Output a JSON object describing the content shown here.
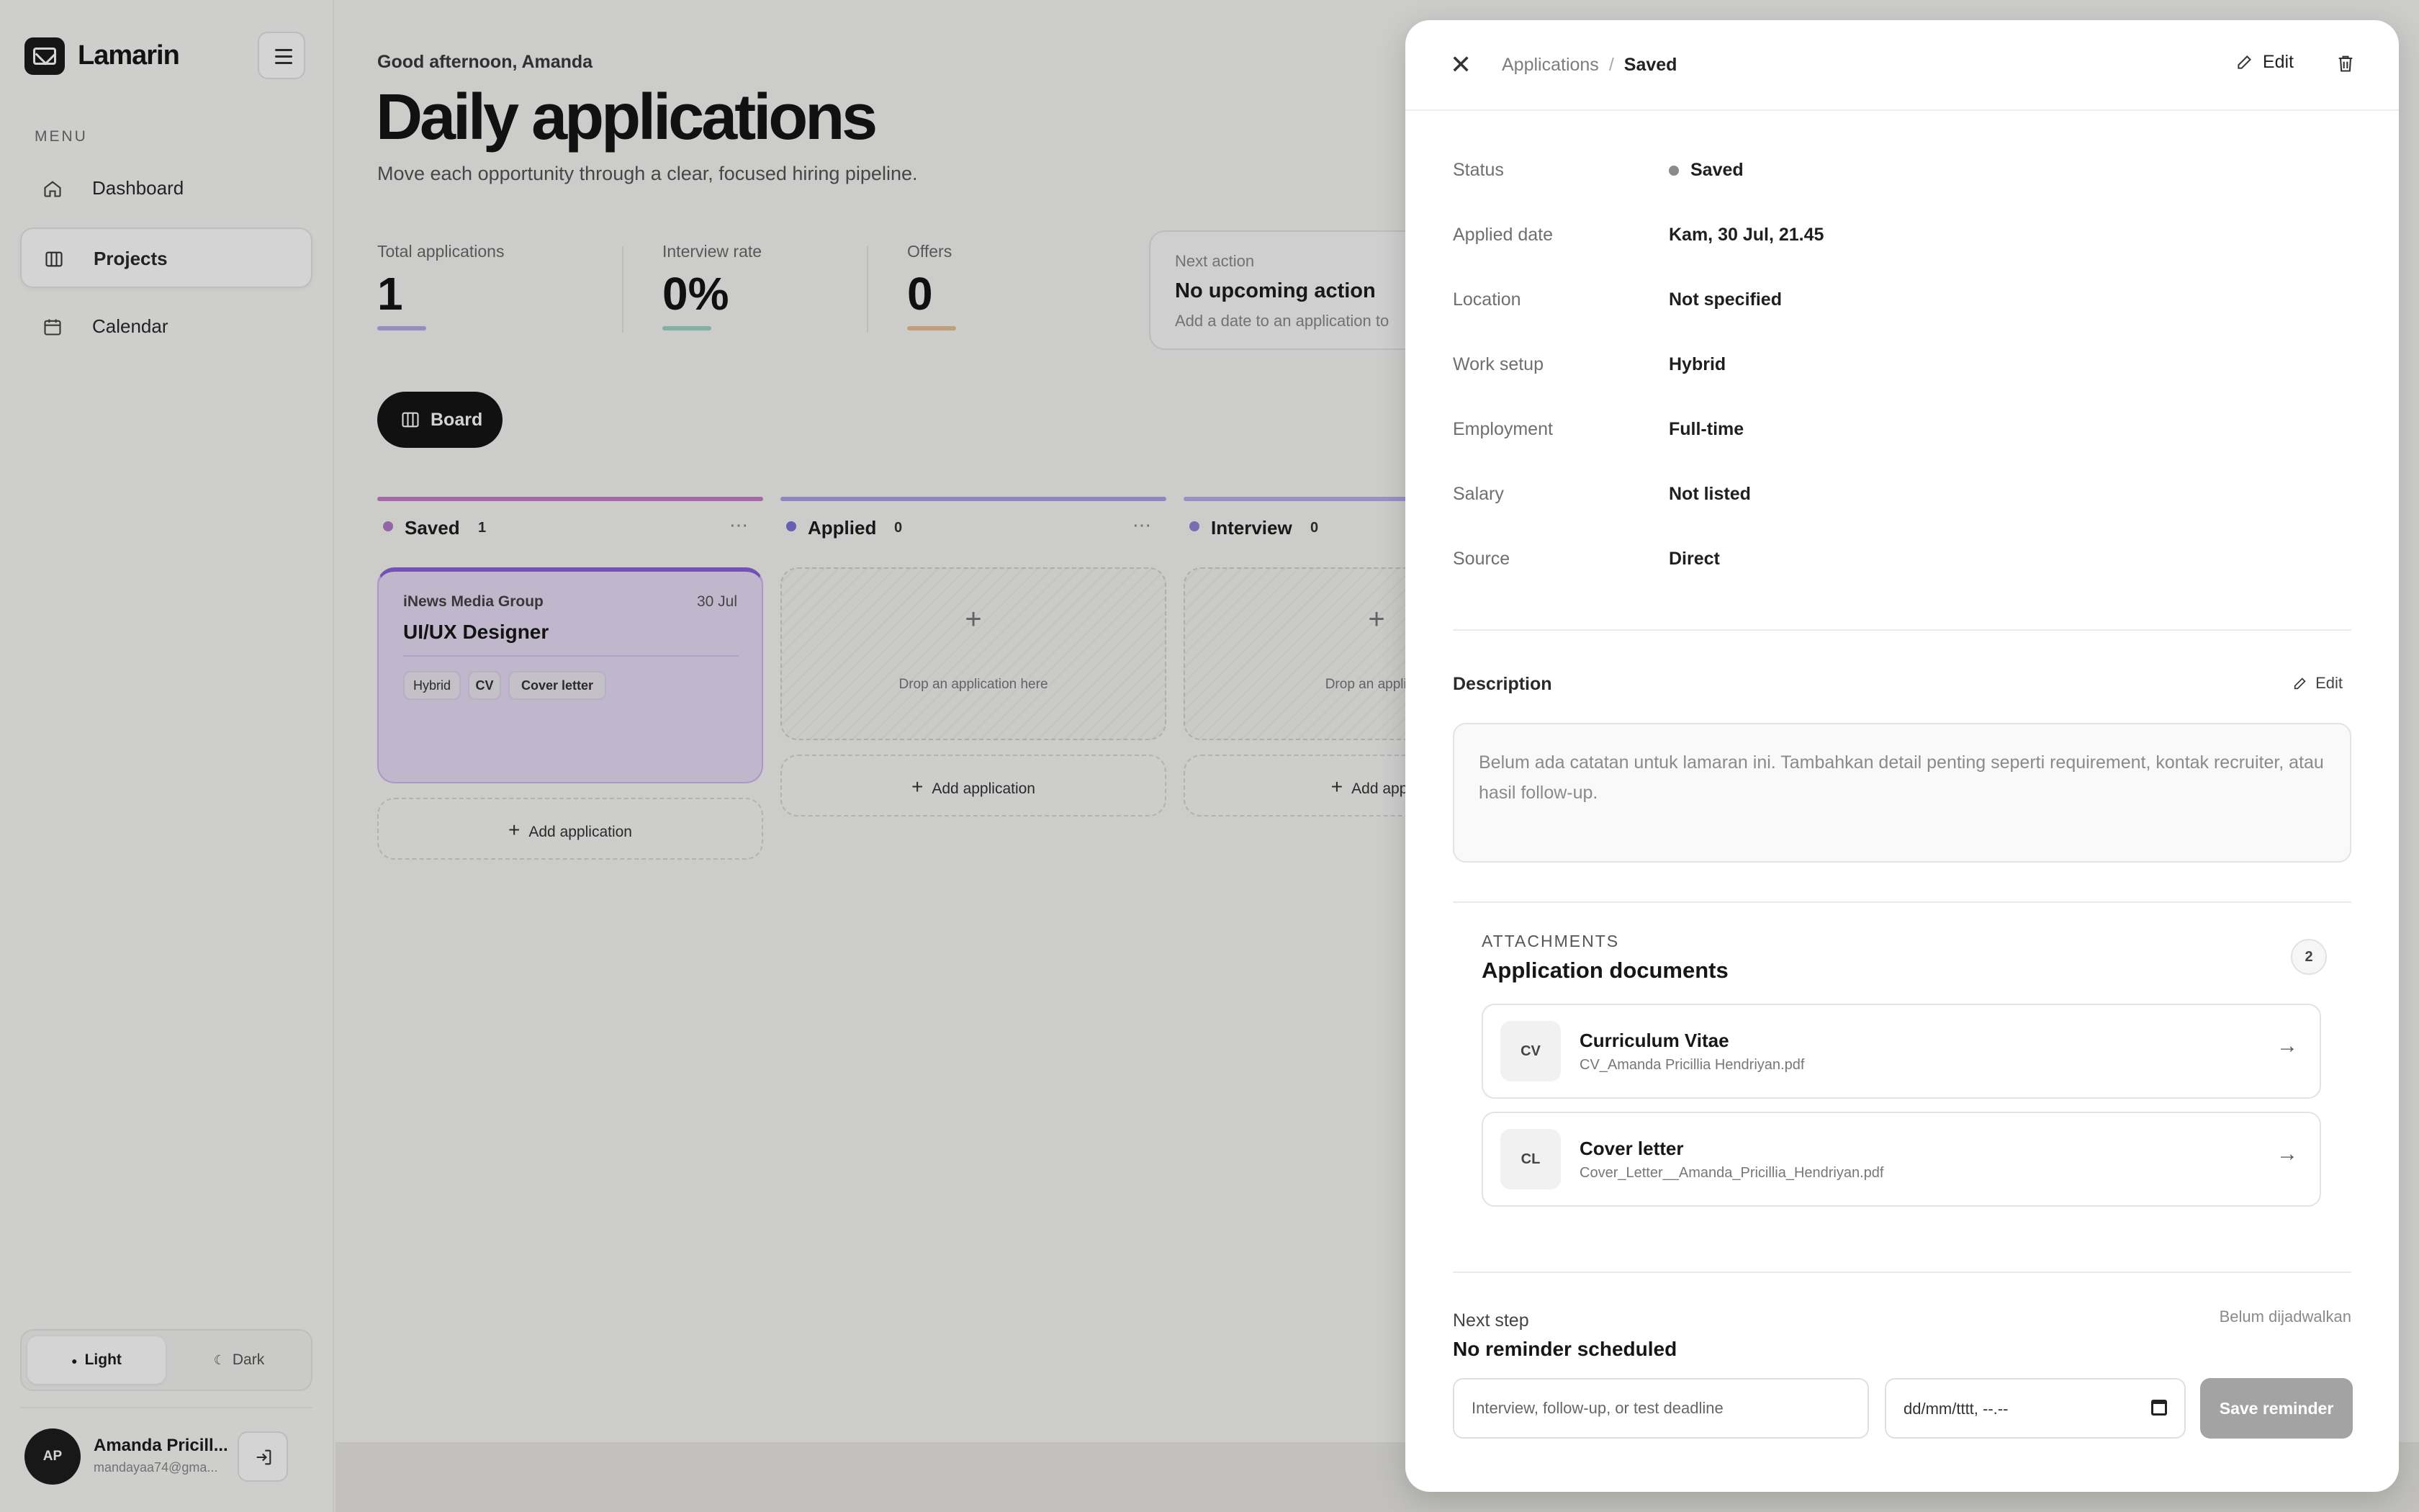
{
  "app": {
    "name": "Lamarin"
  },
  "sidebar": {
    "menu_label": "MENU",
    "items": [
      {
        "label": "Dashboard",
        "icon": "home-icon"
      },
      {
        "label": "Projects",
        "icon": "columns-icon",
        "active": true
      },
      {
        "label": "Calendar",
        "icon": "calendar-icon"
      }
    ],
    "theme": {
      "light_label": "Light",
      "dark_label": "Dark",
      "selected": "Light"
    },
    "user": {
      "initials": "AP",
      "name": "Amanda Pricill...",
      "email": "mandayaa74@gma..."
    }
  },
  "main": {
    "greeting": "Good afternoon, Amanda",
    "title": "Daily applications",
    "subtitle": "Move each opportunity through a clear, focused hiring pipeline.",
    "stats": [
      {
        "label": "Total applications",
        "value": "1",
        "color": "#b9a9e8"
      },
      {
        "label": "Interview rate",
        "value": "0%",
        "color": "#9fd5c4"
      },
      {
        "label": "Offers",
        "value": "0",
        "color": "#e9c08f"
      }
    ],
    "next_action": {
      "label": "Next action",
      "value": "No upcoming action",
      "hint": "Add a date to an application to"
    },
    "view_button": "Board",
    "columns": [
      {
        "name": "Saved",
        "count": "1",
        "color": "#c87fc7",
        "dot": "#b07ac9"
      },
      {
        "name": "Applied",
        "count": "0",
        "color": "#a9a3e6",
        "dot": "#7d71d6"
      },
      {
        "name": "Interview",
        "count": "0",
        "color": "#b7b0ea",
        "dot": "#9285d8"
      }
    ],
    "card": {
      "company": "iNews Media Group",
      "date": "30 Jul",
      "role": "UI/UX Designer",
      "tags": [
        "Hybrid",
        "CV",
        "Cover letter"
      ]
    },
    "drop_text": "Drop an application here",
    "drop_text_partial": "Drop an applicati",
    "add_label": "Add application",
    "add_label_partial": "Add applic"
  },
  "panel": {
    "breadcrumb": {
      "parent": "Applications",
      "current": "Saved"
    },
    "edit_label": "Edit",
    "fields": [
      {
        "key": "Status",
        "value": "Saved"
      },
      {
        "key": "Applied date",
        "value": "Kam, 30 Jul, 21.45"
      },
      {
        "key": "Location",
        "value": "Not specified"
      },
      {
        "key": "Work setup",
        "value": "Hybrid"
      },
      {
        "key": "Employment",
        "value": "Full-time"
      },
      {
        "key": "Salary",
        "value": "Not listed"
      },
      {
        "key": "Source",
        "value": "Direct"
      }
    ],
    "description": {
      "title": "Description",
      "edit_label": "Edit",
      "placeholder": "Belum ada catatan untuk lamaran ini. Tambahkan detail penting seperti requirement, kontak recruiter, atau hasil follow-up."
    },
    "attachments": {
      "overline": "ATTACHMENTS",
      "title": "Application documents",
      "count": "2",
      "docs": [
        {
          "abbr": "CV",
          "name": "Curriculum Vitae",
          "file": "CV_Amanda Pricillia Hendriyan.pdf"
        },
        {
          "abbr": "CL",
          "name": "Cover letter",
          "file": "Cover_Letter__Amanda_Pricillia_Hendriyan.pdf"
        }
      ]
    },
    "next_step": {
      "label": "Next step",
      "value": "No reminder scheduled",
      "status": "Belum dijadwalkan",
      "input_placeholder": "Interview, follow-up, or test deadline",
      "date_placeholder": "dd/mm/tttt, --.--",
      "save_label": "Save reminder"
    }
  }
}
